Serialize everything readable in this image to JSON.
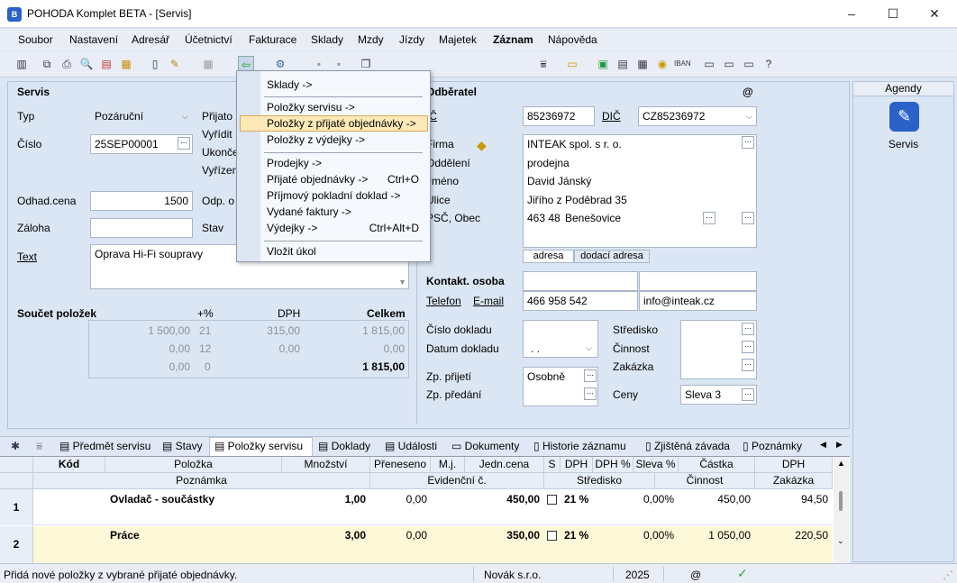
{
  "window": {
    "title": "POHODA Komplet BETA - [Servis]",
    "app_icon": "pohoda-icon",
    "min_glyph": "–",
    "max_glyph": "☐",
    "close_glyph": "✕"
  },
  "menu": [
    "Soubor",
    "Nastavení",
    "Adresář",
    "Účetnictví",
    "Fakturace",
    "Sklady",
    "Mzdy",
    "Jízdy",
    "Majetek",
    "Záznam",
    "Nápověda"
  ],
  "toolbar": {
    "combo_value": ""
  },
  "form": {
    "section_title": "Servis",
    "typ_label": "Typ",
    "typ_value": "Pozáruční",
    "cislo_label": "Číslo",
    "cislo_value": "25SEP00001",
    "prijato_label": "Přijato",
    "vyridit_label": "Vyřídit",
    "ukonceno_label": "Ukonče",
    "vyrizeno_label": "Vyřízen",
    "odhad_label": "Odhad.cena",
    "odhad_value": "1500",
    "zaloha_label": "Záloha",
    "zaloha_value": "",
    "odp_label": "Odp. o",
    "stav_label": "Stav",
    "text_label": "Text",
    "text_value": "Oprava Hi-Fi soupravy",
    "soucet_label": "Součet položek",
    "plus_pct": "+%",
    "dph_col": "DPH",
    "celkem_col": "Celkem",
    "rows": [
      {
        "base": "1 500,00",
        "pct": "21",
        "dph": "315,00",
        "total": "1 815,00"
      },
      {
        "base": "0,00",
        "pct": "12",
        "dph": "0,00",
        "total": "0,00"
      },
      {
        "base": "0,00",
        "pct": "0",
        "dph": "",
        "total": "1 815,00"
      }
    ]
  },
  "odberatel": {
    "title": "Odběratel",
    "at": "@",
    "ic_label": "IČ",
    "ic_value": "85236972",
    "dic_label": "DIČ",
    "dic_value": "CZ85236972",
    "firma_label": "Firma",
    "firma_value": "INTEAK spol. s r. o.",
    "oddeleni_label": "Oddělení",
    "oddeleni_value": "prodejna",
    "jmeno_label": "Jméno",
    "jmeno_value": "David Jánský",
    "ulice_label": "Ulice",
    "ulice_value": "Jiřího z Poděbrad 35",
    "psc_label": "PSČ, Obec",
    "psc_value": "463 48",
    "obec_value": "Benešovice",
    "tab_adresa": "adresa",
    "tab_dodaci": "dodací adresa",
    "kontakt_label": "Kontakt. osoba",
    "telefon_label": "Telefon",
    "email_label": "E-mail",
    "telefon_value": "466 958 542",
    "email_value": "info@inteak.cz",
    "cislo_dokladu_label": "Číslo dokladu",
    "datum_dokladu_label": "Datum dokladu",
    "datum_value": " .  .",
    "zp_prijeti_label": "Zp. přijetí",
    "zp_prijeti_value": "Osobně",
    "zp_predani_label": "Zp. předání",
    "stredisko_label": "Středisko",
    "cinnost_label": "Činnost",
    "zakazka_label": "Zakázka",
    "ceny_label": "Ceny",
    "ceny_value": "Sleva 3"
  },
  "context_menu": {
    "items": [
      {
        "label": "Sklady ->",
        "shortcut": ""
      },
      {
        "label": "Položky servisu ->",
        "shortcut": ""
      },
      {
        "label": "Položky z přijaté objednávky ->",
        "shortcut": ""
      },
      {
        "label": "Položky z výdejky ->",
        "shortcut": ""
      },
      {
        "label": "Prodejky ->",
        "shortcut": ""
      },
      {
        "label": "Přijaté objednávky ->",
        "shortcut": "Ctrl+O"
      },
      {
        "label": "Příjmový pokladní doklad ->",
        "shortcut": ""
      },
      {
        "label": "Vydané faktury ->",
        "shortcut": ""
      },
      {
        "label": "Výdejky ->",
        "shortcut": "Ctrl+Alt+D"
      },
      {
        "label": "Vložit úkol",
        "shortcut": ""
      }
    ]
  },
  "agendy": {
    "title": "Agendy",
    "item": "Servis"
  },
  "tabs": [
    "Předmět servisu",
    "Stavy",
    "Položky servisu",
    "Doklady",
    "Události",
    "Dokumenty",
    "Historie záznamu",
    "Zjištěná závada",
    "Poznámky"
  ],
  "grid": {
    "headers1": [
      "Kód",
      "Položka",
      "Množství",
      "Přeneseno",
      "M.j.",
      "Jedn.cena",
      "S",
      "DPH",
      "DPH %",
      "Sleva %",
      "Částka",
      "DPH"
    ],
    "headers2": [
      "Poznámka",
      "Evidenční č.",
      "Středisko",
      "Činnost",
      "Zakázka"
    ],
    "rows": [
      {
        "num": "1",
        "polozka": "Ovladač - součástky",
        "mnozstvi": "1,00",
        "preneseno": "0,00",
        "mj": "",
        "cena": "450,00",
        "dph": "21 %",
        "dphpct": "",
        "sleva": "0,00%",
        "castka": "450,00",
        "dphval": "94,50"
      },
      {
        "num": "2",
        "polozka": "Práce",
        "mnozstvi": "3,00",
        "preneseno": "0,00",
        "mj": "",
        "cena": "350,00",
        "dph": "21 %",
        "dphpct": "",
        "sleva": "0,00%",
        "castka": "1 050,00",
        "dphval": "220,50"
      }
    ]
  },
  "status": {
    "text": "Přidá nové položky z vybrané přijaté objednávky.",
    "company": "Novák s.r.o.",
    "year": "2025",
    "at": "@"
  },
  "colors": {
    "accent": "#2a62c9",
    "highlight": "#fce9b7",
    "row2": "#fdf8d8"
  }
}
